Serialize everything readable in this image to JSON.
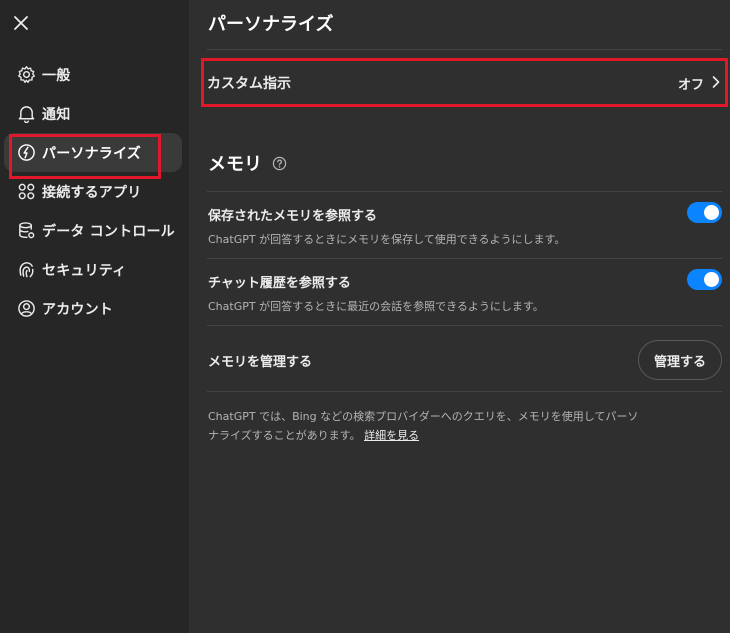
{
  "sidebar": {
    "close_icon": "close-icon",
    "items": [
      {
        "label": "一般",
        "icon": "gear-icon"
      },
      {
        "label": "通知",
        "icon": "bell-icon"
      },
      {
        "label": "パーソナライズ",
        "icon": "personalize-icon",
        "active": true
      },
      {
        "label": "接続するアプリ",
        "icon": "apps-grid-icon"
      },
      {
        "label": "データ コントロール",
        "icon": "database-icon"
      },
      {
        "label": "セキュリティ",
        "icon": "fingerprint-icon"
      },
      {
        "label": "アカウント",
        "icon": "user-circle-icon"
      }
    ]
  },
  "main": {
    "title": "パーソナライズ",
    "custom_instructions": {
      "label": "カスタム指示",
      "value": "オフ"
    },
    "memory": {
      "title": "メモリ",
      "settings": [
        {
          "title": "保存されたメモリを参照する",
          "description": "ChatGPT が回答するときにメモリを保存して使用できるようにします。",
          "enabled": true
        },
        {
          "title": "チャット履歴を参照する",
          "description": "ChatGPT が回答するときに最近の会話を参照できるようにします。",
          "enabled": true
        }
      ],
      "manage": {
        "label": "メモリを管理する",
        "button": "管理する"
      },
      "footnote": "ChatGPT では、Bing などの検索プロバイダーへのクエリを、メモリを使用してパーソナライズすることがあります。",
      "footnote_link": "詳細を見る"
    }
  },
  "colors": {
    "accent": "#0a84ff",
    "highlight": "#e0182a",
    "sidebar_bg": "#262626",
    "main_bg": "#2f2f2f"
  }
}
